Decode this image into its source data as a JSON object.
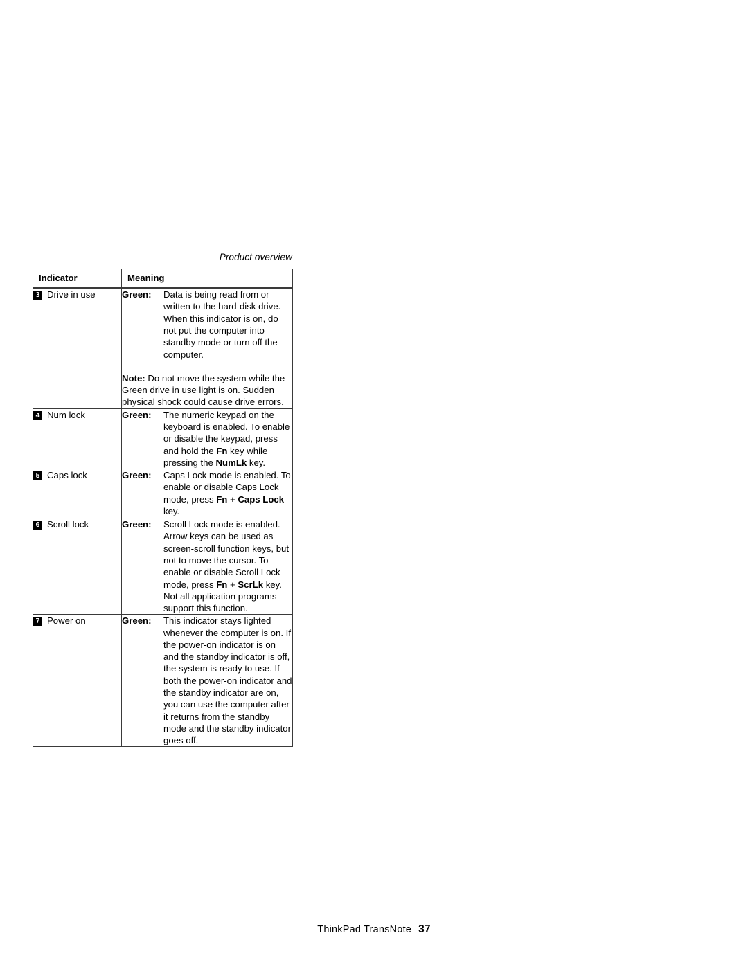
{
  "header": {
    "running_head": "Product overview"
  },
  "table": {
    "columns": [
      "Indicator",
      "Meaning"
    ],
    "rows": [
      {
        "number": "3",
        "indicator": "Drive in use",
        "key": "Green:",
        "description": "Data is being read from or written to the hard-disk drive. When this indicator is on, do not put the computer into standby mode or turn off the computer.",
        "note_label": "Note:",
        "note": " Do not move the system while the Green drive in use light is on. Sudden physical shock could cause drive errors."
      },
      {
        "number": "4",
        "indicator": "Num lock",
        "key": "Green:",
        "desc_part1": "The numeric keypad on the keyboard is enabled. To enable or disable the keypad, press and hold the ",
        "bold1": "Fn",
        "desc_part2": " key while pressing the ",
        "bold2": "NumLk",
        "desc_part3": " key."
      },
      {
        "number": "5",
        "indicator": "Caps lock",
        "key": "Green:",
        "desc_part1": "Caps Lock mode is enabled. To enable or disable Caps Lock mode, press ",
        "bold1": "Fn",
        "desc_part2": " + ",
        "bold2": "Caps Lock",
        "desc_part3": " key."
      },
      {
        "number": "6",
        "indicator": "Scroll lock",
        "key": "Green:",
        "desc_part1": "Scroll Lock mode is enabled. Arrow keys can be used as screen-scroll function keys, but not to move the cursor. To enable or disable Scroll Lock mode, press ",
        "bold1": "Fn",
        "desc_part2": " + ",
        "bold2": "ScrLk",
        "desc_part3": " key. Not all application programs support this function."
      },
      {
        "number": "7",
        "indicator": "Power on",
        "key": "Green:",
        "description": "This indicator stays lighted whenever the computer is on. If the power-on indicator is on and the standby indicator is off, the system is ready to use. If both the power-on indicator and the standby indicator are on, you can use the computer after it returns from the standby mode and the standby indicator goes off."
      }
    ]
  },
  "footer": {
    "book_title": "ThinkPad TransNote",
    "page_number": "37"
  }
}
